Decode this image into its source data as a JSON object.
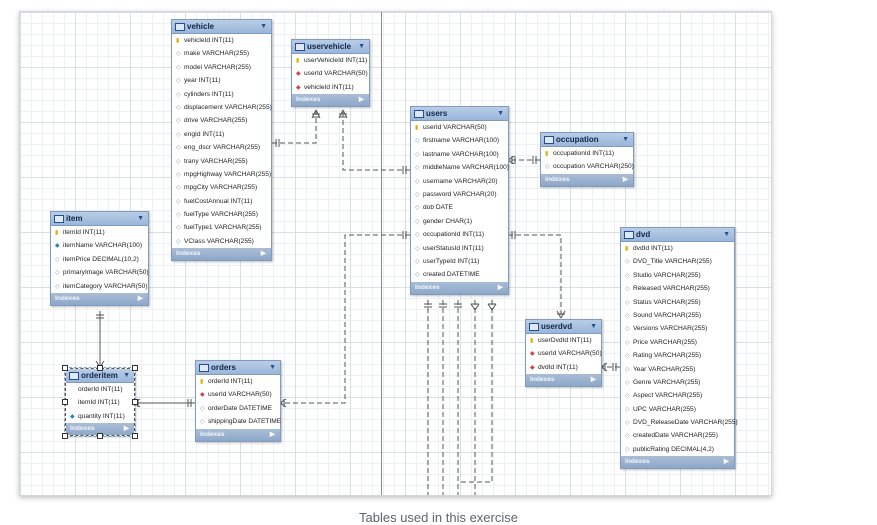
{
  "caption": "Tables used in this exercise",
  "indexes_label": "Indexes",
  "tables": {
    "vehicle": {
      "name": "vehicle",
      "columns": [
        {
          "key": "pk",
          "text": "vehicleId INT(11)"
        },
        {
          "key": "no",
          "text": "make VARCHAR(255)"
        },
        {
          "key": "no",
          "text": "model VARCHAR(255)"
        },
        {
          "key": "no",
          "text": "year INT(11)"
        },
        {
          "key": "no",
          "text": "cylinders INT(11)"
        },
        {
          "key": "no",
          "text": "displacement VARCHAR(255)"
        },
        {
          "key": "no",
          "text": "drive VARCHAR(255)"
        },
        {
          "key": "no",
          "text": "engId INT(11)"
        },
        {
          "key": "no",
          "text": "eng_dscr VARCHAR(255)"
        },
        {
          "key": "no",
          "text": "trany VARCHAR(255)"
        },
        {
          "key": "no",
          "text": "mpgHighway VARCHAR(255)"
        },
        {
          "key": "no",
          "text": "mpgCity VARCHAR(255)"
        },
        {
          "key": "no",
          "text": "fuelCostAnnual INT(11)"
        },
        {
          "key": "no",
          "text": "fuelType VARCHAR(255)"
        },
        {
          "key": "no",
          "text": "fuelType1 VARCHAR(255)"
        },
        {
          "key": "no",
          "text": "VClass VARCHAR(255)"
        }
      ]
    },
    "uservehicle": {
      "name": "uservehicle",
      "columns": [
        {
          "key": "pk",
          "text": "userVehicleId INT(11)"
        },
        {
          "key": "fk",
          "text": "userId VARCHAR(50)"
        },
        {
          "key": "fk",
          "text": "vehicleId INT(11)"
        }
      ]
    },
    "users": {
      "name": "users",
      "columns": [
        {
          "key": "pk",
          "text": "userId VARCHAR(50)"
        },
        {
          "key": "no",
          "text": "firstname VARCHAR(100)"
        },
        {
          "key": "no",
          "text": "lastname VARCHAR(100)"
        },
        {
          "key": "no",
          "text": "middleName VARCHAR(100)"
        },
        {
          "key": "no",
          "text": "username VARCHAR(20)"
        },
        {
          "key": "no",
          "text": "password VARCHAR(20)"
        },
        {
          "key": "no",
          "text": "dob DATE"
        },
        {
          "key": "no",
          "text": "gender CHAR(1)"
        },
        {
          "key": "no",
          "text": "occupationId INT(11)"
        },
        {
          "key": "no",
          "text": "userStatusId INT(11)"
        },
        {
          "key": "no",
          "text": "userTypeId INT(11)"
        },
        {
          "key": "no",
          "text": "created DATETIME"
        }
      ]
    },
    "occupation": {
      "name": "occupation",
      "columns": [
        {
          "key": "pk",
          "text": "occupationId INT(11)"
        },
        {
          "key": "no",
          "text": "occupation VARCHAR(250)"
        }
      ]
    },
    "item": {
      "name": "item",
      "columns": [
        {
          "key": "pk",
          "text": "itemId INT(11)"
        },
        {
          "key": "nn",
          "text": "itemName VARCHAR(100)"
        },
        {
          "key": "no",
          "text": "itemPrice DECIMAL(10,2)"
        },
        {
          "key": "no",
          "text": "primaryImage VARCHAR(50)"
        },
        {
          "key": "no",
          "text": "itemCategory VARCHAR(50)"
        }
      ]
    },
    "dvd": {
      "name": "dvd",
      "columns": [
        {
          "key": "pk",
          "text": "dvdId INT(11)"
        },
        {
          "key": "no",
          "text": "DVD_Title VARCHAR(255)"
        },
        {
          "key": "no",
          "text": "Studio VARCHAR(255)"
        },
        {
          "key": "no",
          "text": "Released VARCHAR(255)"
        },
        {
          "key": "no",
          "text": "Status VARCHAR(255)"
        },
        {
          "key": "no",
          "text": "Sound VARCHAR(255)"
        },
        {
          "key": "no",
          "text": "Versions VARCHAR(255)"
        },
        {
          "key": "no",
          "text": "Price VARCHAR(255)"
        },
        {
          "key": "no",
          "text": "Rating VARCHAR(255)"
        },
        {
          "key": "no",
          "text": "Year VARCHAR(255)"
        },
        {
          "key": "no",
          "text": "Genre VARCHAR(255)"
        },
        {
          "key": "no",
          "text": "Aspect VARCHAR(255)"
        },
        {
          "key": "no",
          "text": "UPC VARCHAR(255)"
        },
        {
          "key": "no",
          "text": "DVD_ReleaseDate VARCHAR(255)"
        },
        {
          "key": "no",
          "text": "createdDate VARCHAR(255)"
        },
        {
          "key": "no",
          "text": "publicRating DECIMAL(4,2)"
        }
      ]
    },
    "userdvd": {
      "name": "userdvd",
      "columns": [
        {
          "key": "pk",
          "text": "userDvdId INT(11)"
        },
        {
          "key": "fk",
          "text": "userId VARCHAR(50)"
        },
        {
          "key": "fk",
          "text": "dvdId INT(11)"
        }
      ]
    },
    "orders": {
      "name": "orders",
      "columns": [
        {
          "key": "pk",
          "text": "orderId INT(11)"
        },
        {
          "key": "fk",
          "text": "userId VARCHAR(50)"
        },
        {
          "key": "no",
          "text": "orderDate DATETIME"
        },
        {
          "key": "no",
          "text": "shippingDate DATETIME"
        }
      ]
    },
    "orderitem": {
      "name": "orderitem",
      "columns": [
        {
          "key": "none",
          "text": "orderId INT(11)"
        },
        {
          "key": "none",
          "text": "itemId INT(11)"
        },
        {
          "key": "nn",
          "text": "quantity INT(11)"
        }
      ]
    }
  }
}
